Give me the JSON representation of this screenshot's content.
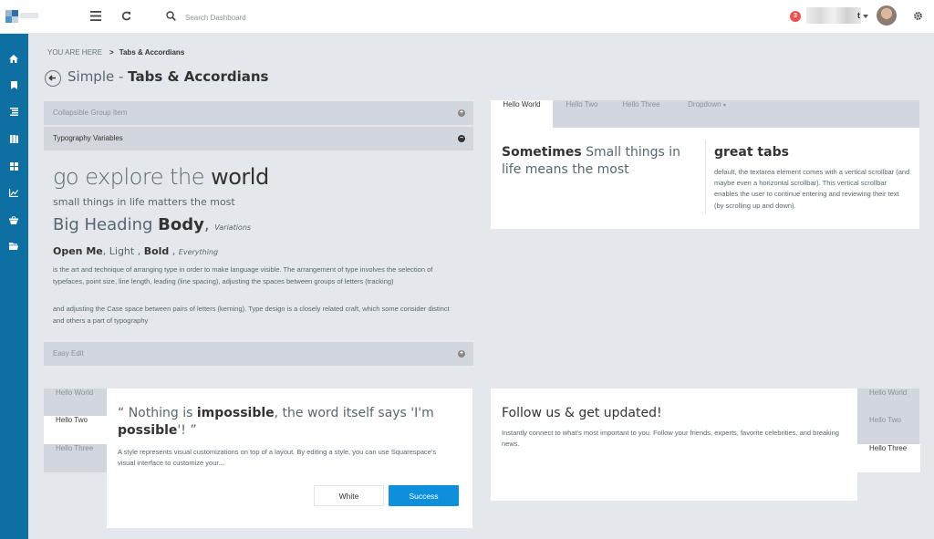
{
  "app": {
    "search_placeholder": "Search Dashboard",
    "notification_count": "3",
    "username_tail": "t",
    "brand_colors": {
      "sidebar": "#0e6fa3",
      "success": "#0d8fdb",
      "badge": "#f05050"
    }
  },
  "sidebar": {
    "icons": [
      "home-icon",
      "bookmark-icon",
      "list-icon",
      "book-icon",
      "grid-icon",
      "chart-icon",
      "basket-icon",
      "folder-icon"
    ]
  },
  "breadcrumb": {
    "prefix": "YOU ARE HERE",
    "separator": ">",
    "current": "Tabs & Accordians"
  },
  "page": {
    "title_light": "Simple - ",
    "title_bold": "Tabs & Accordians"
  },
  "accordion": {
    "items": [
      {
        "label": "Collapsible Group Item",
        "toggle": "+"
      },
      {
        "label": "Typography Variables",
        "toggle": "−"
      },
      {
        "label": "Easy Edit",
        "toggle": "+"
      }
    ],
    "typography": {
      "big_light": "go explore the ",
      "big_bold": "world",
      "small": "small things in life matters the most",
      "mid_light": "Big Heading ",
      "mid_bold": "Body",
      "mid_comma": ", ",
      "mid_italic": "Variations",
      "w_bold1": "Open Me",
      "w_light": ", Light , ",
      "w_bold2": "Bold",
      "w_comma": " , ",
      "w_italic": "Everything",
      "para1": "is the art and technique of arranging type in order to make language visible. The arrangement of type involves the selection of typefaces, point size, line length, leading (line spacing), adjusting the spaces between groups of letters (tracking)",
      "para2": "and adjusting the Case space between pairs of letters (kerning). Type design is a closely related craft, which some consider distinct and others a part of typography"
    }
  },
  "tabs_card": {
    "tabs": [
      "Hello World",
      "Hello Two",
      "Hello Three",
      "Dropdown"
    ],
    "dropdown_caret": "▾",
    "left_bold": "Sometimes",
    "left_light": " Small things in life means the most",
    "right_title": "great tabs",
    "right_text": "default, the textarea element comes with a vertical scrollbar (and maybe even a horizontal scrollbar). This vertical scrollbar enables the user to continue entering and reviewing their text (by scrolling up and down)."
  },
  "quote_card": {
    "tabs": [
      "Hello World",
      "Hello Two",
      "Hello Three"
    ],
    "q_open": "“ Nothing is ",
    "q_bold1": "impossible",
    "q_mid": ", the word itself says 'I'm ",
    "q_bold2": "possible",
    "q_close": "'! ”",
    "text": "A style represents visual customizations on top of a layout. By editing a style, you can use Squarespace's visual interface to customize your...",
    "btn_white": "White",
    "btn_success": "Success"
  },
  "follow_card": {
    "title": "Follow us & get updated!",
    "text": "Instantly connect to what's most important to you. Follow your friends, experts, favorite celebrities, and breaking news.",
    "tabs": [
      "Hello World",
      "Hello Two",
      "Hello Three"
    ]
  }
}
